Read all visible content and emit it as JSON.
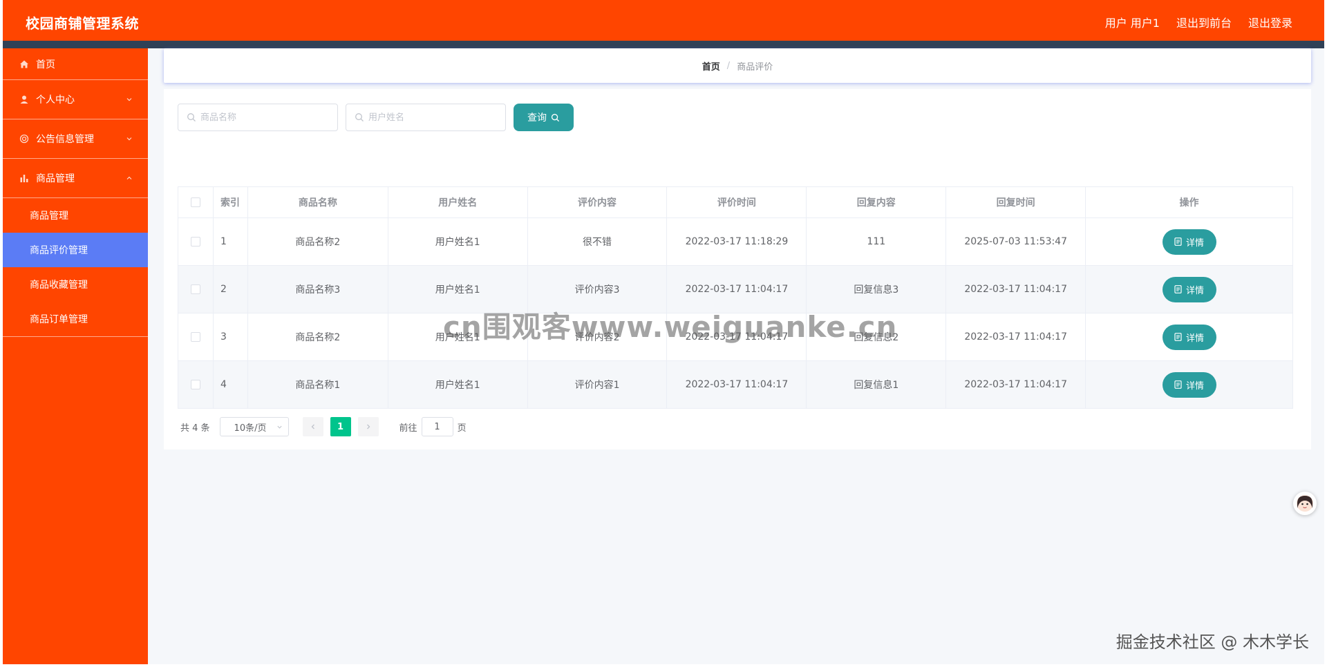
{
  "header": {
    "title": "校园商铺管理系统",
    "user_label": "用户 用户1",
    "front_link": "退出到前台",
    "logout": "退出登录"
  },
  "sidebar": {
    "items": [
      {
        "label": "首页",
        "icon": "home-icon"
      },
      {
        "label": "个人中心",
        "icon": "user-icon"
      },
      {
        "label": "公告信息管理",
        "icon": "notice-icon"
      },
      {
        "label": "商品管理",
        "icon": "chart-icon"
      }
    ],
    "sub_items": [
      "商品管理",
      "商品评价管理",
      "商品收藏管理",
      "商品订单管理"
    ]
  },
  "breadcrumb": {
    "home": "首页",
    "separator": "/",
    "current": "商品评价"
  },
  "search": {
    "product_placeholder": "商品名称",
    "user_placeholder": "用户姓名",
    "query_label": "查询"
  },
  "table": {
    "headers": [
      "索引",
      "商品名称",
      "用户姓名",
      "评价内容",
      "评价时间",
      "回复内容",
      "回复时间",
      "操作"
    ],
    "rows": [
      {
        "idx": "1",
        "product": "商品名称2",
        "user": "用户姓名1",
        "content": "很不错",
        "time": "2022-03-17 11:18:29",
        "reply": "111",
        "reply_time": "2025-07-03 11:53:47"
      },
      {
        "idx": "2",
        "product": "商品名称3",
        "user": "用户姓名1",
        "content": "评价内容3",
        "time": "2022-03-17 11:04:17",
        "reply": "回复信息3",
        "reply_time": "2022-03-17 11:04:17"
      },
      {
        "idx": "3",
        "product": "商品名称2",
        "user": "用户姓名1",
        "content": "评价内容2",
        "time": "2022-03-17 11:04:17",
        "reply": "回复信息2",
        "reply_time": "2022-03-17 11:04:17"
      },
      {
        "idx": "4",
        "product": "商品名称1",
        "user": "用户姓名1",
        "content": "评价内容1",
        "time": "2022-03-17 11:04:17",
        "reply": "回复信息1",
        "reply_time": "2022-03-17 11:04:17"
      }
    ],
    "detail_label": "详情"
  },
  "pager": {
    "total": "共 4 条",
    "page_size": "10条/页",
    "current_page": "1",
    "goto_prefix": "前往",
    "goto_value": "1",
    "goto_suffix": "页"
  },
  "watermark": "cn围观客www.weiguanke.cn",
  "footer_mark": "掘金技术社区 @ 木木学长",
  "colors": {
    "header": "#ff4500",
    "sidebar": "#ff4500",
    "active": "#5b7cf5",
    "primary": "#2a9d9f",
    "pager_active": "#00c48c"
  }
}
